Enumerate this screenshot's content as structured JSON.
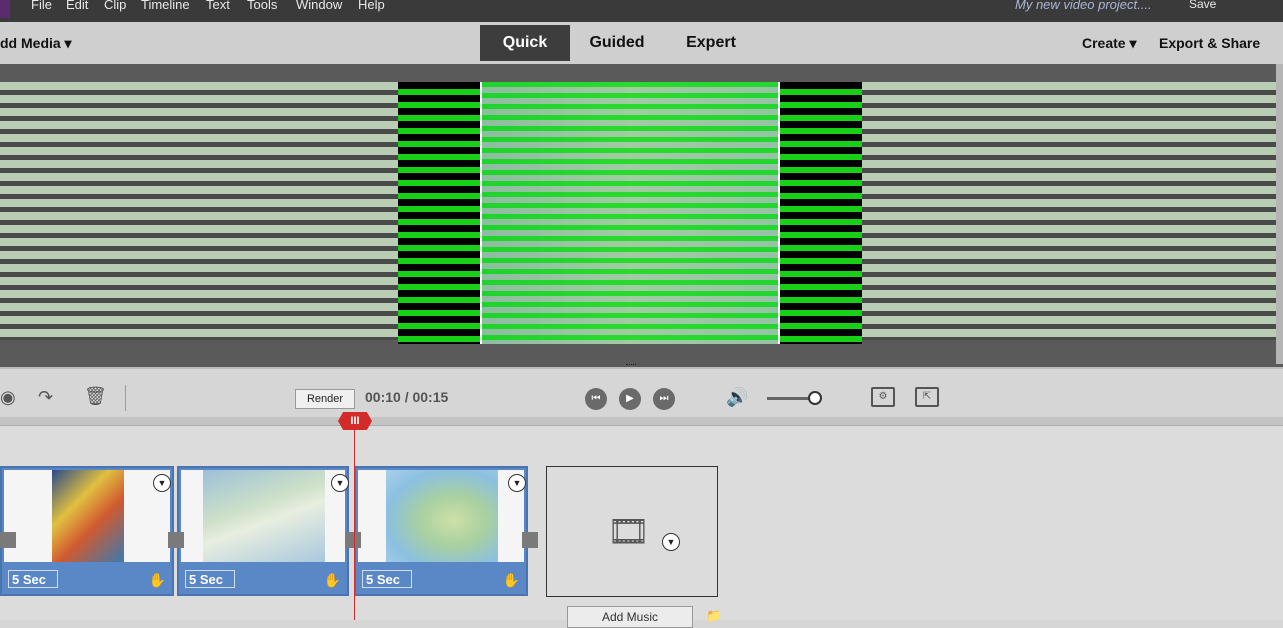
{
  "menu": {
    "items": [
      "File",
      "Edit",
      "Clip",
      "Timeline",
      "Text",
      "Tools",
      "Window",
      "Help"
    ],
    "project_title": "My new video project....",
    "save_label": "Save"
  },
  "toolbar": {
    "add_media_label": "dd Media ▾",
    "tabs": [
      {
        "label": "Quick",
        "active": true
      },
      {
        "label": "Guided",
        "active": false
      },
      {
        "label": "Expert",
        "active": false
      }
    ],
    "create_label": "Create ▾",
    "export_label": "Export & Share"
  },
  "controls": {
    "render_label": "Render",
    "timecode": "00:10 / 00:15",
    "volume_level": 0.9
  },
  "timeline": {
    "playhead_glyph": "III",
    "clips": [
      {
        "duration": "5 Sec",
        "thumb": "weather-map"
      },
      {
        "duration": "5 Sec",
        "thumb": "flight-route-map"
      },
      {
        "duration": "5 Sec",
        "thumb": "uk-map"
      }
    ],
    "add_music_label": "Add Music"
  },
  "colors": {
    "accent_blue": "#5a87c5",
    "playhead_red": "#d42a2a",
    "active_tab": "#3d3d3d"
  }
}
